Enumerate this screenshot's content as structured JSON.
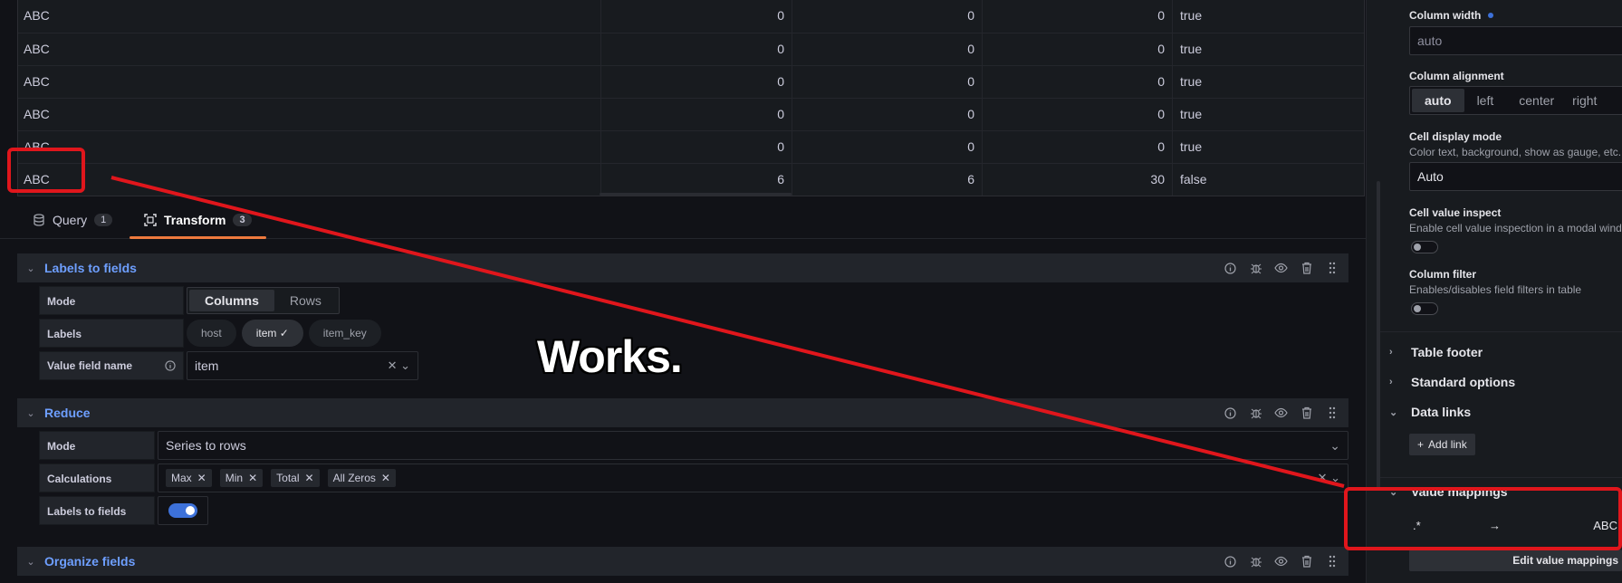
{
  "table": {
    "rows": [
      [
        "ABC",
        "0",
        "0",
        "0",
        "true"
      ],
      [
        "ABC",
        "0",
        "0",
        "0",
        "true"
      ],
      [
        "ABC",
        "0",
        "0",
        "0",
        "true"
      ],
      [
        "ABC",
        "0",
        "0",
        "0",
        "true"
      ],
      [
        "ABC",
        "0",
        "0",
        "0",
        "true"
      ],
      [
        "ABC",
        "6",
        "6",
        "30",
        "false"
      ]
    ]
  },
  "tabs": {
    "query": {
      "label": "Query",
      "count": "1"
    },
    "transform": {
      "label": "Transform",
      "count": "3"
    }
  },
  "labels_to_fields": {
    "title": "Labels to fields",
    "mode_label": "Mode",
    "mode_options": [
      "Columns",
      "Rows"
    ],
    "labels_label": "Labels",
    "labels": [
      "host",
      "item ✓",
      "item_key"
    ],
    "value_field_label": "Value field name",
    "value_field_value": "item"
  },
  "reduce": {
    "title": "Reduce",
    "mode_label": "Mode",
    "mode_value": "Series to rows",
    "calc_label": "Calculations",
    "calcs": [
      "Max",
      "Min",
      "Total",
      "All Zeros"
    ],
    "ltf_label": "Labels to fields"
  },
  "organize": {
    "title": "Organize fields"
  },
  "right": {
    "col_width_label": "Column width",
    "col_width_value": "auto",
    "col_align_label": "Column alignment",
    "col_align_options": [
      "auto",
      "left",
      "center",
      "right"
    ],
    "cell_mode_label": "Cell display mode",
    "cell_mode_desc": "Color text, background, show as gauge, etc.",
    "cell_mode_value": "Auto",
    "cell_inspect_label": "Cell value inspect",
    "cell_inspect_desc": "Enable cell value inspection in a modal window",
    "col_filter_label": "Column filter",
    "col_filter_desc": "Enables/disables field filters in table",
    "table_footer": "Table footer",
    "standard_options": "Standard options",
    "data_links": "Data links",
    "add_link": "Add link",
    "value_mappings": "Value mappings",
    "mapping_from": ".*",
    "mapping_to": "ABC",
    "edit_mappings": "Edit value mappings"
  },
  "annotation": {
    "text": "Works."
  },
  "colors": {
    "accent": "#6e9fff",
    "tab_underline": "#ee7a3e",
    "annotation": "#e0161c"
  }
}
